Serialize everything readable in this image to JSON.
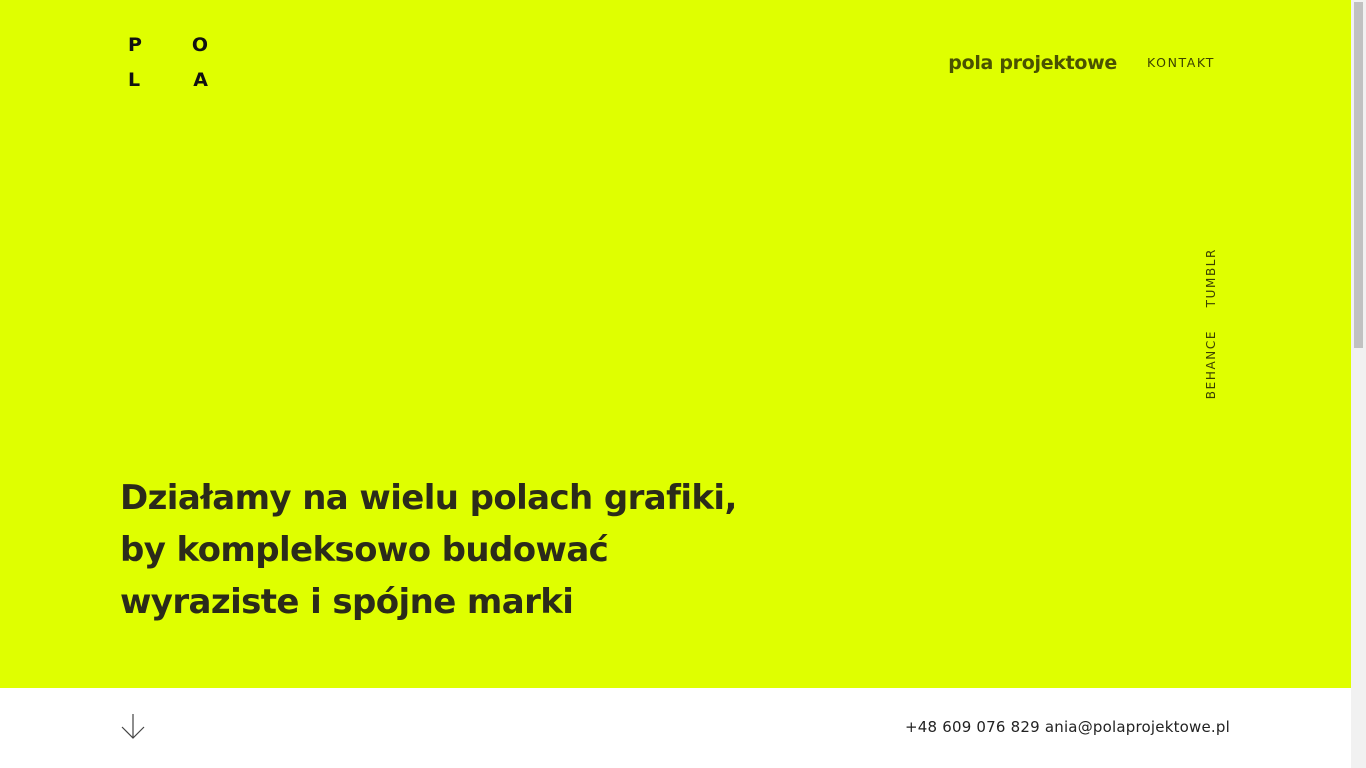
{
  "logo": {
    "letters": [
      "P",
      "O",
      "L",
      "A"
    ]
  },
  "nav": {
    "brand": "pola projektowe",
    "contact": "KONTAKT"
  },
  "social": {
    "tumblr": "TUMBLR",
    "behance": "BEHANCE"
  },
  "hero": {
    "headline_lines": [
      "Działamy na wielu polach grafiki,",
      "by kompleksowo budować",
      "wyraziste i spójne marki"
    ]
  },
  "footer": {
    "phone": "+48 609 076 829",
    "email": "ania@polaprojektowe.pl"
  },
  "colors": {
    "accent": "#dfff00",
    "text": "#2b2b1a",
    "nav_text": "#4a5200"
  },
  "icons": {
    "scroll": "arrow-down-icon"
  }
}
